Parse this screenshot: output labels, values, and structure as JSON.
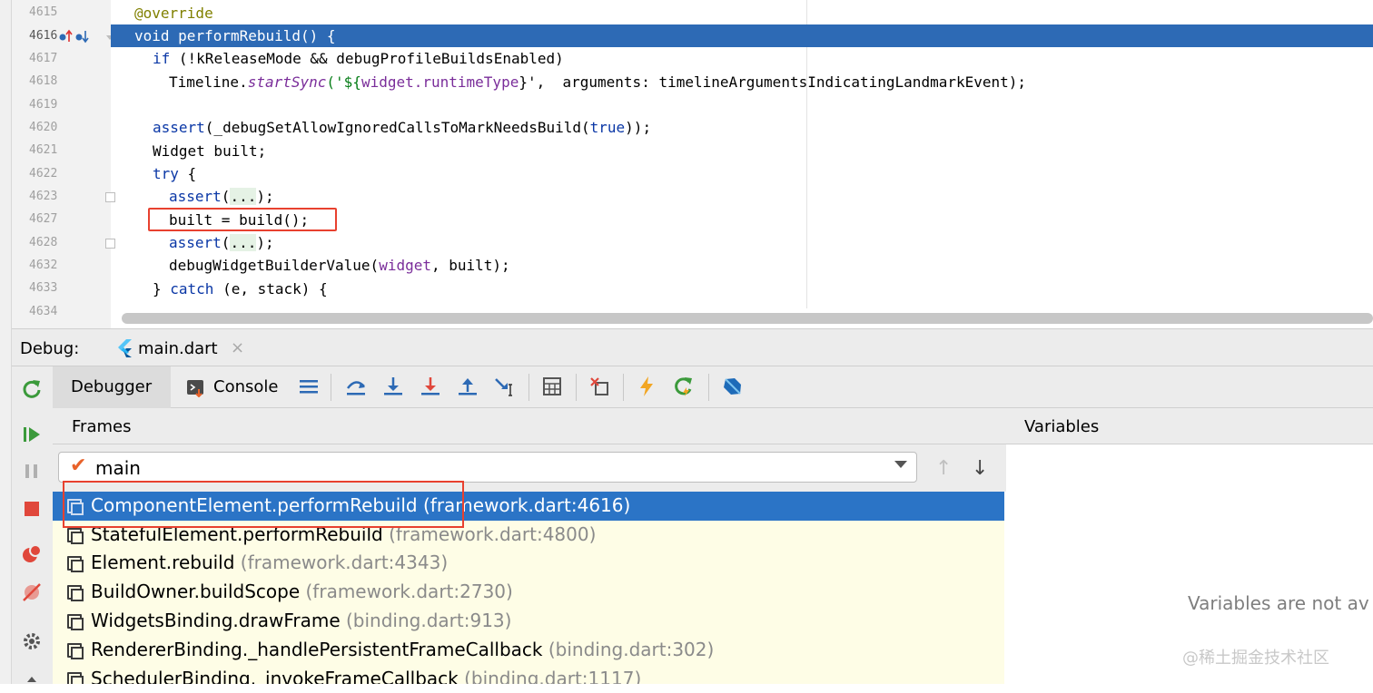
{
  "editor": {
    "line_numbers": [
      "4615",
      "4616",
      "4617",
      "4618",
      "4619",
      "4620",
      "4621",
      "4622",
      "4623",
      "4627",
      "4628",
      "4632",
      "4633",
      "4634"
    ],
    "lines": [
      {
        "text": "@override"
      },
      {
        "kw": "void ",
        "text": "performRebuild() {"
      },
      {
        "kw": "if ",
        "text": "(!kReleaseMode && debugProfileBuildsEnabled)"
      },
      {
        "pre": "Timeline.",
        "it": "startSync",
        "text": "('${",
        "fld": "widget.runtimeType",
        "post": "}',  arguments: timelineArgumentsIndicatingLandmarkEvent);"
      },
      {
        "text": ""
      },
      {
        "kw": "assert",
        "text": "(_debugSetAllowIgnoredCallsToMarkNeedsBuild(",
        "kw2": "true",
        "post": "));"
      },
      {
        "text": "Widget built;"
      },
      {
        "kw": "try ",
        "text": "{"
      },
      {
        "kw": "assert",
        "fold": "...",
        "post": ");"
      },
      {
        "text": "built = build();"
      },
      {
        "kw": "assert",
        "fold": "...",
        "post": ");"
      },
      {
        "text": "debugWidgetBuilderValue(",
        "fld": "widget",
        "post": ", built);"
      },
      {
        "pre": "} ",
        "kw": "catch ",
        "text": "(e, stack) {"
      },
      {
        "text": ""
      }
    ]
  },
  "debug": {
    "label": "Debug:",
    "session_tab": "main.dart",
    "close_glyph": "×"
  },
  "toolbar": {
    "debugger_tab": "Debugger",
    "console_tab": "Console",
    "icons": [
      "menu-icon",
      "step-over-icon",
      "step-into-icon",
      "force-step-into-icon",
      "step-out-icon",
      "run-to-cursor-icon",
      "evaluate-icon",
      "drop-frame-icon",
      "hot-reload-icon",
      "hot-restart-icon",
      "dart-devtools-icon"
    ]
  },
  "frames": {
    "title": "Frames",
    "thread": "main",
    "items": [
      {
        "name": "ComponentElement.performRebuild",
        "loc": "(framework.dart:4616)",
        "selected": true
      },
      {
        "name": "StatefulElement.performRebuild",
        "loc": "(framework.dart:4800)"
      },
      {
        "name": "Element.rebuild",
        "loc": "(framework.dart:4343)"
      },
      {
        "name": "BuildOwner.buildScope",
        "loc": "(framework.dart:2730)"
      },
      {
        "name": "WidgetsBinding.drawFrame",
        "loc": "(binding.dart:913)"
      },
      {
        "name": "RendererBinding._handlePersistentFrameCallback",
        "loc": "(binding.dart:302)"
      },
      {
        "name": "SchedulerBinding._invokeFrameCallback",
        "loc": "(binding.dart:1117)"
      }
    ]
  },
  "variables": {
    "title": "Variables",
    "empty_text": "Variables are not av"
  },
  "watermark": "@稀土掘金技术社区",
  "colors": {
    "selection": "#2d6ab5",
    "frame_selection": "#2b74c6",
    "annotation_red": "#e8412f",
    "frames_bg": "#fefde6"
  }
}
